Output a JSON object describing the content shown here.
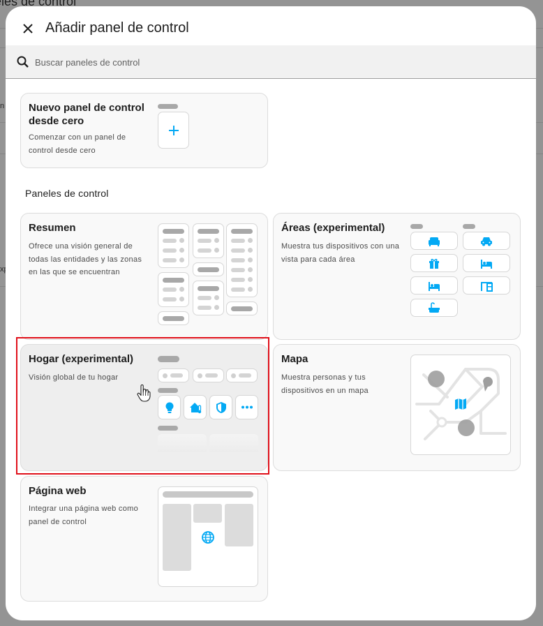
{
  "background": {
    "title_fragment": "eles de control",
    "fragment_left_1": "n",
    "fragment_left_2": "xp"
  },
  "dialog": {
    "title": "Añadir panel de control",
    "close_icon": "close-icon"
  },
  "search": {
    "placeholder": "Buscar paneles de control",
    "value": ""
  },
  "new_card": {
    "title": "Nuevo panel de control desde cero",
    "description": "Comenzar con un panel de control desde cero"
  },
  "section": {
    "heading": "Paneles de control"
  },
  "cards": {
    "overview": {
      "title": "Resumen",
      "description": "Ofrece una visión general de todas las entidades y las zonas en las que se encuentran"
    },
    "areas": {
      "title": "Áreas (experimental)",
      "description": "Muestra tus dispositivos con una vista para cada área",
      "icons": [
        "sofa-icon",
        "car-icon",
        "gift-icon",
        "bed-icon",
        "bed-icon",
        "desk-icon",
        "bathtub-icon"
      ]
    },
    "home": {
      "title": "Hogar (experimental)",
      "description": "Visión global de tu hogar",
      "icons": [
        "lightbulb-icon",
        "home-thermometer-icon",
        "shield-icon",
        "more-icon"
      ]
    },
    "map": {
      "title": "Mapa",
      "description": "Muestra personas y tus dispositivos en un mapa"
    },
    "webpage": {
      "title": "Página web",
      "description": "Integrar una página web como panel de control"
    }
  },
  "colors": {
    "accent": "#03a9f4",
    "highlight": "#e0101a",
    "placeholder": "#a8a8a8"
  }
}
